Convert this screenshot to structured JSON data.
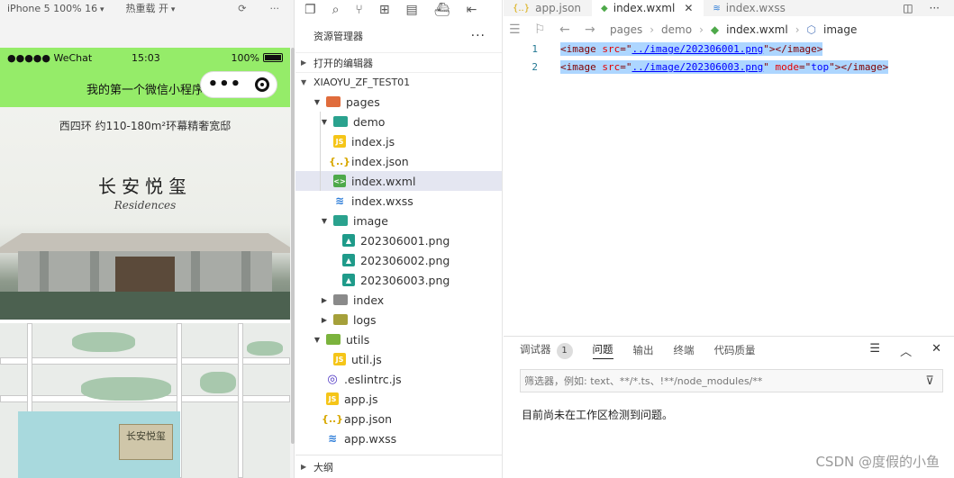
{
  "simulator": {
    "device": "iPhone 5 100% 16",
    "hot_reload": "热重载 开",
    "status": {
      "carrier": "●●●●● WeChat",
      "time": "15:03",
      "battery": "100%"
    },
    "nav_title": "我的第一个微信小程序",
    "image1": {
      "slogan": "西四环 约110-180m²环幕精奢宽邸",
      "brand": "长安悦玺",
      "brand_sub": "Residences"
    },
    "image2": {
      "sign": "长安悦玺"
    }
  },
  "explorer": {
    "title": "资源管理器",
    "more": "···",
    "open_editors": "打开的编辑器",
    "project": "XIAOYU_ZF_TEST01",
    "tree": [
      {
        "label": "pages"
      },
      {
        "label": "demo"
      },
      {
        "label": "index.js"
      },
      {
        "label": "index.json"
      },
      {
        "label": "index.wxml"
      },
      {
        "label": "index.wxss"
      },
      {
        "label": "image"
      },
      {
        "label": "202306001.png"
      },
      {
        "label": "202306002.png"
      },
      {
        "label": "202306003.png"
      },
      {
        "label": "index"
      },
      {
        "label": "logs"
      },
      {
        "label": "utils"
      },
      {
        "label": "util.js"
      },
      {
        "label": ".eslintrc.js"
      },
      {
        "label": "app.js"
      },
      {
        "label": "app.json"
      },
      {
        "label": "app.wxss"
      }
    ],
    "outline": "大纲"
  },
  "editor": {
    "tabs": [
      {
        "label": "app.json"
      },
      {
        "label": "index.wxml"
      },
      {
        "label": "index.wxss"
      }
    ],
    "breadcrumb": [
      "pages",
      "demo",
      "index.wxml",
      "image"
    ],
    "lines": [
      {
        "num": "1",
        "tag_open": "<image",
        "attr1": "src",
        "eq": "=\"",
        "val1": "../image/202306001.png",
        "end": "\"></image>",
        "attr2": "",
        "val2": ""
      },
      {
        "num": "2",
        "tag_open": "<image",
        "attr1": "src",
        "eq": "=\"",
        "val1": "../image/202306003.png",
        "end": "\"></image>",
        "attr2": "mode",
        "val2": "top"
      }
    ]
  },
  "panel": {
    "tabs": [
      "调试器",
      "问题",
      "输出",
      "终端",
      "代码质量"
    ],
    "debugger_badge": "1",
    "filter_placeholder": "筛选器，例如: text、**/*.ts、!**/node_modules/**",
    "message": "目前尚未在工作区检测到问题。"
  },
  "watermark": "CSDN @度假的小鱼"
}
